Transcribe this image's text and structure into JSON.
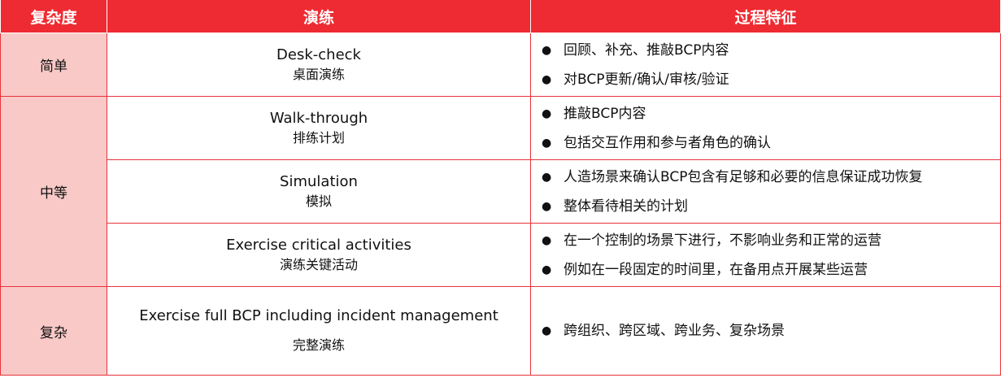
{
  "header": {
    "complexity": "复杂度",
    "drill": "演练",
    "features": "过程特征"
  },
  "rows": [
    {
      "level": "简单",
      "drill_en": "Desk-check",
      "drill_zh": "桌面演练",
      "features": [
        "回顾、补充、推敲BCP内容",
        "对BCP更新/确认/审核/验证"
      ]
    },
    {
      "level": "中等",
      "drill_en": "Walk-through",
      "drill_zh": "排练计划",
      "features": [
        "推敲BCP内容",
        "包括交互作用和参与者角色的确认"
      ]
    },
    {
      "drill_en": "Simulation",
      "drill_zh": "模拟",
      "features": [
        "人造场景来确认BCP包含有足够和必要的信息保证成功恢复",
        "整体看待相关的计划"
      ]
    },
    {
      "drill_en": "Exercise critical activities",
      "drill_zh": "演练关键活动",
      "features": [
        "在一个控制的场景下进行，不影响业务和正常的运营",
        "例如在一段固定的时间里，在备用点开展某些运营"
      ]
    },
    {
      "level": "复杂",
      "drill_en": "Exercise full BCP including incident management",
      "drill_zh": "完整演练",
      "features": [
        "跨组织、跨区域、跨业务、复杂场景"
      ]
    }
  ],
  "colors": {
    "header_bg": "#ee2b32",
    "level_bg": "#f9c9c7",
    "border": "#e8333a"
  }
}
